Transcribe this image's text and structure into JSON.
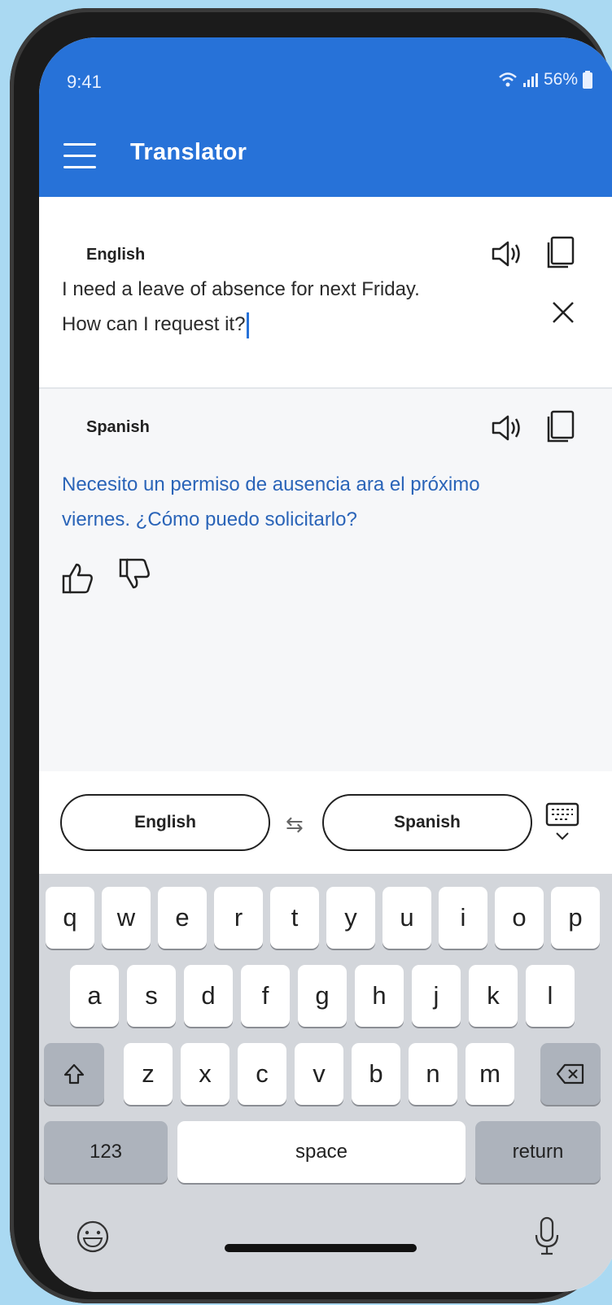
{
  "status": {
    "time": "9:41",
    "battery": "56%"
  },
  "app": {
    "title": "Translator"
  },
  "source": {
    "language": "English",
    "text_line1": "I need a leave of absence for next Friday.",
    "text_line2": "How can I request it?"
  },
  "target": {
    "language": "Spanish",
    "text_line1": "Necesito un permiso de ausencia ara el próximo",
    "text_line2": "viernes. ¿Cómo puedo solicitarlo?"
  },
  "selector": {
    "from": "English",
    "to": "Spanish",
    "swap_icon": "⇆"
  },
  "keyboard": {
    "row1": [
      "q",
      "w",
      "e",
      "r",
      "t",
      "y",
      "u",
      "i",
      "o",
      "p"
    ],
    "row2": [
      "a",
      "s",
      "d",
      "f",
      "g",
      "h",
      "j",
      "k",
      "l"
    ],
    "row3": [
      "z",
      "x",
      "c",
      "v",
      "b",
      "n",
      "m"
    ],
    "numbers": "123",
    "space": "space",
    "return": "return"
  },
  "colors": {
    "accent": "#2772d8",
    "translation": "#2a64b8",
    "keyboard_bg": "#d3d6db"
  }
}
